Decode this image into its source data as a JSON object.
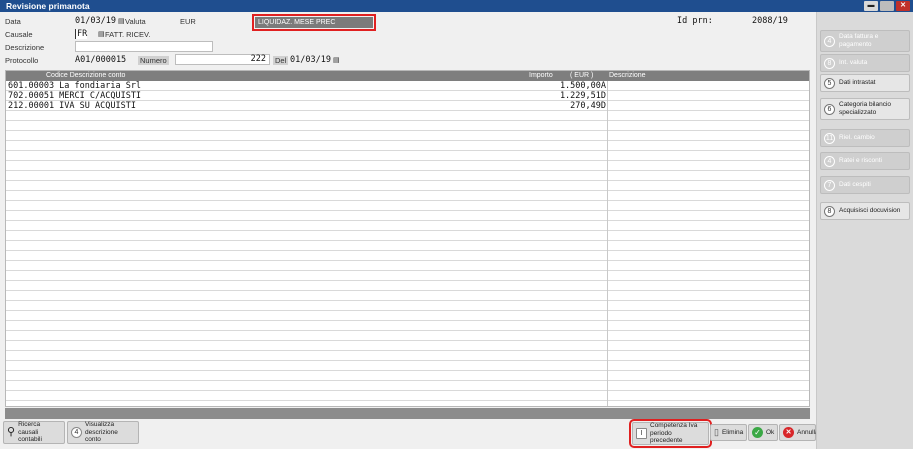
{
  "window": {
    "title": "Revisione primanota",
    "min": "▬",
    "max": "□",
    "close": "✕"
  },
  "form": {
    "data_label": "Data",
    "data_value": "01/03/19",
    "valuta_label": "Valuta",
    "valuta_value": "EUR",
    "liquidaz": "LIQUIDAZ. MESE PREC",
    "idprn_label": "Id prn:",
    "idprn_value": "2088/19",
    "causale_label": "Causale",
    "causale_code": "FR",
    "causale_desc": "FATT. RICEV.",
    "descrizione_label": "Descrizione",
    "descrizione_value": "",
    "protocollo_label": "Protocollo",
    "protocollo_value": "A01/000015",
    "numero_label": "Numero",
    "numero_value": "222",
    "del_label": "Del",
    "del_value": "01/03/19"
  },
  "grid": {
    "headers": {
      "codice": "Codice Descrizione conto",
      "importo": "Importo",
      "valuta": "( EUR )",
      "descrizione": "Descrizione"
    },
    "rows": [
      {
        "account": "601.00003 La fondiaria Srl",
        "amount": "1.500,00A"
      },
      {
        "account": "702.00051 MERCI C/ACQUISTI",
        "amount": "1.229,51D"
      },
      {
        "account": "212.00001 IVA SU ACQUISTI",
        "amount": "270,49D"
      }
    ]
  },
  "bottom": {
    "ricerca": "Ricerca causali contabili",
    "visualizza_key": "4",
    "visualizza": "Visualizza descrizione conto",
    "competenza_key": "I",
    "competenza": "Competenza Iva periodo precedente",
    "elimina": "Elimina",
    "ok": "Ok",
    "annulla": "Annulla"
  },
  "side": [
    {
      "key": "4",
      "label": "Data fattura e pagamento",
      "active": false
    },
    {
      "key": "8",
      "label": "Int. valuta",
      "active": false
    },
    {
      "key": "5",
      "label": "Dati intrastat",
      "active": true
    },
    {
      "key": "6",
      "label": "Categoria bilancio specializzato",
      "active": true
    },
    {
      "key": "11",
      "label": "Riel. cambio",
      "active": false
    },
    {
      "key": "4",
      "label": "Ratei e risconti",
      "active": false
    },
    {
      "key": "7",
      "label": "Dati cespiti",
      "active": false
    },
    {
      "key": "8",
      "label": "Acquisisci docuvision",
      "active": true
    }
  ]
}
